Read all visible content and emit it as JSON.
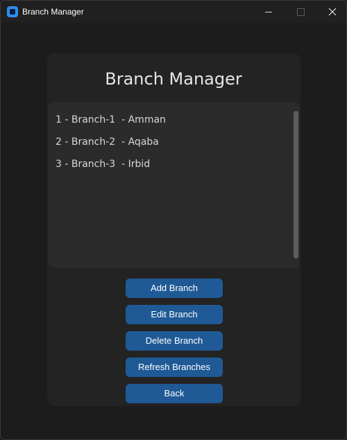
{
  "window": {
    "title": "Branch Manager",
    "icon": "app-icon",
    "controls": [
      "minimize-icon",
      "maximize-icon",
      "close-icon"
    ]
  },
  "main": {
    "title": "Branch Manager",
    "branches": [
      "1 - Branch-1  - Amman",
      "2 - Branch-2  - Aqaba",
      "3 - Branch-3  - Irbid"
    ]
  },
  "actions": {
    "add": "Add Branch",
    "edit": "Edit Branch",
    "delete": "Delete Branch",
    "refresh": "Refresh Branches",
    "back": "Back"
  },
  "colors": {
    "accent": "#1f5a96",
    "background": "#1c1c1c",
    "card": "#232323",
    "list": "#2b2b2b"
  }
}
